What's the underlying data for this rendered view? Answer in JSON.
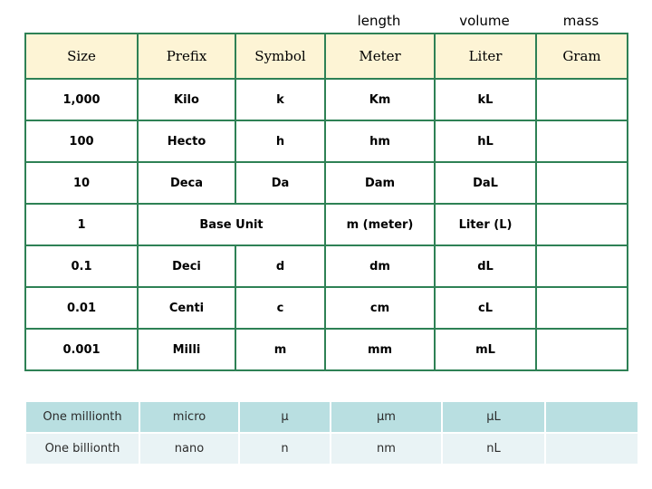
{
  "group_labels": {
    "length": "length",
    "volume": "volume",
    "mass": "mass"
  },
  "main_table": {
    "headers": [
      "Size",
      "Prefix",
      "Symbol",
      "Meter",
      "Liter",
      "Gram"
    ],
    "rows": [
      {
        "size": "1,000",
        "prefix": "Kilo",
        "symbol": "k",
        "meter": "Km",
        "liter": "kL",
        "gram": ""
      },
      {
        "size": "100",
        "prefix": "Hecto",
        "symbol": "h",
        "meter": "hm",
        "liter": "hL",
        "gram": ""
      },
      {
        "size": "10",
        "prefix": "Deca",
        "symbol": "Da",
        "meter": "Dam",
        "liter": "DaL",
        "gram": ""
      },
      {
        "size": "1",
        "prefix": "Base Unit",
        "symbol": "",
        "meter": "m (meter)",
        "liter": "Liter (L)",
        "gram": "",
        "merge_prefix_symbol": true
      },
      {
        "size": "0.1",
        "prefix": "Deci",
        "symbol": "d",
        "meter": "dm",
        "liter": "dL",
        "gram": ""
      },
      {
        "size": "0.01",
        "prefix": "Centi",
        "symbol": "c",
        "meter": "cm",
        "liter": "cL",
        "gram": ""
      },
      {
        "size": "0.001",
        "prefix": "Milli",
        "symbol": "m",
        "meter": "mm",
        "liter": "mL",
        "gram": ""
      }
    ]
  },
  "sub_table": {
    "rows": [
      {
        "size": "One millionth",
        "prefix": "micro",
        "symbol": "µ",
        "meter": "µm",
        "liter": "µL",
        "gram": ""
      },
      {
        "size": "One billionth",
        "prefix": "nano",
        "symbol": "n",
        "meter": "nm",
        "liter": "nL",
        "gram": ""
      }
    ]
  },
  "colors": {
    "header_background": "#FDF4D5",
    "table_border": "#2E8155",
    "sub_row_dark": "#B9DFE1",
    "sub_row_light": "#E9F3F5",
    "text": "#000000"
  }
}
